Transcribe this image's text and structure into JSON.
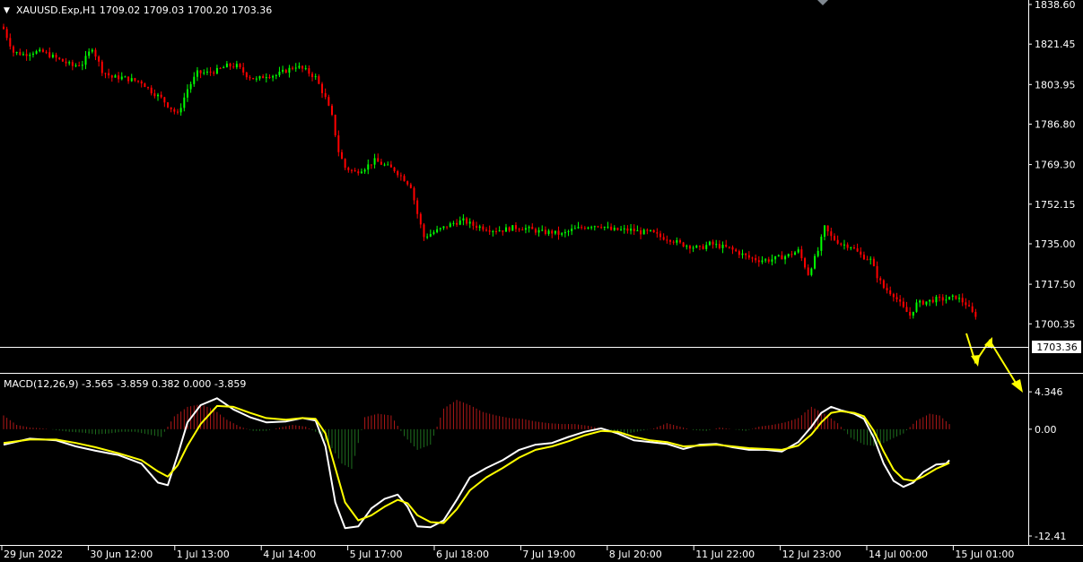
{
  "header": {
    "symbol_menu_glyph": "▼",
    "title": "XAUUSD.Exp,H1  1709.02 1709.03 1700.20 1703.36"
  },
  "macd_header": "MACD(12,26,9) -3.565 -3.859 0.382 0.000 -3.859",
  "colors": {
    "background": "#000000",
    "bull": "#00ff00",
    "bear": "#ff0000",
    "hist_pos": "#b01818",
    "hist_neg": "#1e6e1e",
    "macd_line": "#ffffff",
    "signal_line": "#ffff00",
    "arrow": "#ffff00",
    "axis": "#ffffff"
  },
  "chart_data": [
    {
      "type": "candlestick",
      "title": "XAUUSD.Exp,H1  1709.02 1709.03 1700.20 1703.36",
      "ylim": [
        1686.5,
        1838.6
      ],
      "y_ticks": [
        "1838.60",
        "1821.45",
        "1803.95",
        "1786.80",
        "1769.30",
        "1752.15",
        "1735.00",
        "1717.50",
        "1700.35"
      ],
      "x_ticks": [
        "29 Jun 2022",
        "30 Jun 12:00",
        "1 Jul 13:00",
        "4 Jul 14:00",
        "5 Jul 17:00",
        "6 Jul 18:00",
        "7 Jul 19:00",
        "8 Jul 20:00",
        "11 Jul 22:00",
        "12 Jul 23:00",
        "14 Jul 00:00",
        "15 Jul 01:00"
      ],
      "last_price_label": "1703.36",
      "last_price": 1703.36,
      "close_path": [
        [
          0,
          1828
        ],
        [
          3,
          1818
        ],
        [
          6,
          1817
        ],
        [
          9,
          1818
        ],
        [
          12,
          1818
        ],
        [
          15,
          1816
        ],
        [
          18,
          1814
        ],
        [
          21,
          1812
        ],
        [
          24,
          1813
        ],
        [
          27,
          1820
        ],
        [
          30,
          1810
        ],
        [
          33,
          1807
        ],
        [
          36,
          1807
        ],
        [
          39,
          1806
        ],
        [
          42,
          1805
        ],
        [
          45,
          1801
        ],
        [
          48,
          1798
        ],
        [
          50,
          1795
        ],
        [
          53,
          1791
        ],
        [
          56,
          1802
        ],
        [
          59,
          1809
        ],
        [
          62,
          1809
        ],
        [
          65,
          1810
        ],
        [
          68,
          1812
        ],
        [
          71,
          1812
        ],
        [
          74,
          1808
        ],
        [
          77,
          1806
        ],
        [
          80,
          1808
        ],
        [
          83,
          1808
        ],
        [
          86,
          1810
        ],
        [
          89,
          1812
        ],
        [
          92,
          1810
        ],
        [
          95,
          1807
        ],
        [
          98,
          1798
        ],
        [
          100,
          1790
        ],
        [
          102,
          1775
        ],
        [
          104,
          1768
        ],
        [
          107,
          1766
        ],
        [
          110,
          1768
        ],
        [
          113,
          1771
        ],
        [
          116,
          1769
        ],
        [
          119,
          1767
        ],
        [
          122,
          1763
        ],
        [
          124,
          1760
        ],
        [
          126,
          1748
        ],
        [
          128,
          1738
        ],
        [
          131,
          1740
        ],
        [
          134,
          1742
        ],
        [
          137,
          1744
        ],
        [
          140,
          1745
        ],
        [
          143,
          1743
        ],
        [
          146,
          1742
        ],
        [
          149,
          1741
        ],
        [
          152,
          1741
        ],
        [
          155,
          1742
        ],
        [
          158,
          1742
        ],
        [
          161,
          1741
        ],
        [
          164,
          1740
        ],
        [
          167,
          1740
        ],
        [
          170,
          1739
        ],
        [
          173,
          1741
        ],
        [
          176,
          1742
        ],
        [
          179,
          1743
        ],
        [
          182,
          1743
        ],
        [
          185,
          1741
        ],
        [
          188,
          1741
        ],
        [
          191,
          1741
        ],
        [
          194,
          1740
        ],
        [
          197,
          1740
        ],
        [
          200,
          1738
        ],
        [
          203,
          1737
        ],
        [
          206,
          1735
        ],
        [
          209,
          1734
        ],
        [
          212,
          1733
        ],
        [
          215,
          1735
        ],
        [
          218,
          1734
        ],
        [
          221,
          1733
        ],
        [
          224,
          1731
        ],
        [
          227,
          1729
        ],
        [
          230,
          1728
        ],
        [
          233,
          1728
        ],
        [
          236,
          1729
        ],
        [
          239,
          1730
        ],
        [
          242,
          1732
        ],
        [
          245,
          1722
        ],
        [
          248,
          1732
        ],
        [
          250,
          1742
        ],
        [
          252,
          1738
        ],
        [
          255,
          1735
        ],
        [
          258,
          1734
        ],
        [
          261,
          1730
        ],
        [
          264,
          1728
        ],
        [
          266,
          1721
        ],
        [
          268,
          1716
        ],
        [
          271,
          1713
        ],
        [
          274,
          1707
        ],
        [
          276,
          1704
        ],
        [
          278,
          1709
        ],
        [
          281,
          1710
        ],
        [
          284,
          1711
        ],
        [
          287,
          1711
        ],
        [
          290,
          1712
        ],
        [
          293,
          1709
        ],
        [
          296,
          1703
        ]
      ]
    },
    {
      "type": "line",
      "title": "MACD(12,26,9) -3.565 -3.859 0.382 0.000 -3.859",
      "ylim": [
        -12.41,
        5.4
      ],
      "y_ticks": [
        "4.346",
        "0.00",
        "-12.41"
      ],
      "series": [
        {
          "values": [
            [
              0,
              -1.8
            ],
            [
              8,
              -1.1
            ],
            [
              16,
              -1.3
            ],
            [
              22,
              -2.0
            ],
            [
              28,
              -2.5
            ],
            [
              35,
              -3.0
            ],
            [
              42,
              -4.0
            ],
            [
              47,
              -6.2
            ],
            [
              50,
              -6.5
            ],
            [
              53,
              -3.0
            ],
            [
              56,
              0.8
            ],
            [
              60,
              2.8
            ],
            [
              65,
              3.6
            ],
            [
              70,
              2.3
            ],
            [
              75,
              1.4
            ],
            [
              80,
              0.8
            ],
            [
              86,
              0.9
            ],
            [
              91,
              1.3
            ],
            [
              95,
              1.0
            ],
            [
              98,
              -2.0
            ],
            [
              101,
              -8.5
            ],
            [
              104,
              -11.5
            ],
            [
              108,
              -11.3
            ],
            [
              112,
              -9.2
            ],
            [
              116,
              -8.1
            ],
            [
              120,
              -7.6
            ],
            [
              123,
              -9.0
            ],
            [
              126,
              -11.3
            ],
            [
              130,
              -11.4
            ],
            [
              134,
              -10.6
            ],
            [
              138,
              -8.2
            ],
            [
              142,
              -5.6
            ],
            [
              147,
              -4.5
            ],
            [
              152,
              -3.6
            ],
            [
              157,
              -2.4
            ],
            [
              162,
              -1.8
            ],
            [
              167,
              -1.6
            ],
            [
              172,
              -0.9
            ],
            [
              177,
              -0.3
            ],
            [
              182,
              0.1
            ],
            [
              187,
              -0.5
            ],
            [
              192,
              -1.3
            ],
            [
              197,
              -1.5
            ],
            [
              202,
              -1.7
            ],
            [
              207,
              -2.3
            ],
            [
              212,
              -1.8
            ],
            [
              217,
              -1.7
            ],
            [
              222,
              -2.1
            ],
            [
              227,
              -2.4
            ],
            [
              232,
              -2.4
            ],
            [
              237,
              -2.6
            ],
            [
              242,
              -1.5
            ],
            [
              246,
              0.3
            ],
            [
              249,
              1.9
            ],
            [
              252,
              2.6
            ],
            [
              255,
              2.2
            ],
            [
              259,
              1.8
            ],
            [
              262,
              1.2
            ],
            [
              265,
              -1.0
            ],
            [
              268,
              -4.0
            ],
            [
              271,
              -6.0
            ],
            [
              274,
              -6.7
            ],
            [
              277,
              -6.2
            ],
            [
              280,
              -5.0
            ],
            [
              284,
              -4.1
            ],
            [
              287,
              -4.0
            ],
            [
              288,
              -3.6
            ]
          ]
        },
        {
          "values": [
            [
              0,
              -1.6
            ],
            [
              8,
              -1.2
            ],
            [
              16,
              -1.2
            ],
            [
              22,
              -1.6
            ],
            [
              28,
              -2.1
            ],
            [
              35,
              -2.8
            ],
            [
              42,
              -3.6
            ],
            [
              47,
              -4.9
            ],
            [
              50,
              -5.5
            ],
            [
              53,
              -4.2
            ],
            [
              56,
              -1.9
            ],
            [
              60,
              0.6
            ],
            [
              65,
              2.7
            ],
            [
              70,
              2.6
            ],
            [
              75,
              1.9
            ],
            [
              80,
              1.3
            ],
            [
              86,
              1.1
            ],
            [
              91,
              1.3
            ],
            [
              95,
              1.2
            ],
            [
              98,
              -0.5
            ],
            [
              101,
              -4.5
            ],
            [
              104,
              -8.5
            ],
            [
              108,
              -10.6
            ],
            [
              112,
              -10.0
            ],
            [
              116,
              -9.0
            ],
            [
              120,
              -8.2
            ],
            [
              123,
              -8.6
            ],
            [
              126,
              -10.0
            ],
            [
              130,
              -10.8
            ],
            [
              134,
              -10.9
            ],
            [
              138,
              -9.3
            ],
            [
              142,
              -7.1
            ],
            [
              147,
              -5.6
            ],
            [
              152,
              -4.5
            ],
            [
              157,
              -3.3
            ],
            [
              162,
              -2.4
            ],
            [
              167,
              -2.0
            ],
            [
              172,
              -1.4
            ],
            [
              177,
              -0.7
            ],
            [
              182,
              -0.2
            ],
            [
              187,
              -0.3
            ],
            [
              192,
              -0.9
            ],
            [
              197,
              -1.3
            ],
            [
              202,
              -1.5
            ],
            [
              207,
              -2.0
            ],
            [
              212,
              -1.9
            ],
            [
              217,
              -1.8
            ],
            [
              222,
              -2.0
            ],
            [
              227,
              -2.2
            ],
            [
              232,
              -2.3
            ],
            [
              237,
              -2.4
            ],
            [
              242,
              -1.9
            ],
            [
              246,
              -0.6
            ],
            [
              249,
              0.8
            ],
            [
              252,
              1.9
            ],
            [
              255,
              2.1
            ],
            [
              259,
              1.9
            ],
            [
              262,
              1.5
            ],
            [
              265,
              -0.2
            ],
            [
              268,
              -2.6
            ],
            [
              271,
              -4.7
            ],
            [
              274,
              -5.8
            ],
            [
              277,
              -6.0
            ],
            [
              280,
              -5.5
            ],
            [
              284,
              -4.6
            ],
            [
              287,
              -4.1
            ],
            [
              288,
              -3.9
            ]
          ]
        }
      ],
      "histogram": [
        [
          0,
          1.6
        ],
        [
          4,
          0.5
        ],
        [
          8,
          0.2
        ],
        [
          12,
          0.1
        ],
        [
          16,
          -0.1
        ],
        [
          20,
          -0.3
        ],
        [
          24,
          -0.4
        ],
        [
          28,
          -0.6
        ],
        [
          32,
          -0.5
        ],
        [
          36,
          -0.3
        ],
        [
          40,
          -0.3
        ],
        [
          44,
          -0.6
        ],
        [
          48,
          -0.9
        ],
        [
          52,
          1.5
        ],
        [
          56,
          2.6
        ],
        [
          60,
          2.9
        ],
        [
          64,
          2.3
        ],
        [
          68,
          1.1
        ],
        [
          72,
          0.3
        ],
        [
          76,
          -0.2
        ],
        [
          80,
          -0.2
        ],
        [
          84,
          0.2
        ],
        [
          88,
          0.5
        ],
        [
          92,
          0.3
        ],
        [
          96,
          -0.5
        ],
        [
          100,
          -2.2
        ],
        [
          103,
          -4.0
        ],
        [
          106,
          -4.6
        ],
        [
          110,
          1.4
        ],
        [
          114,
          1.8
        ],
        [
          118,
          1.6
        ],
        [
          122,
          -0.8
        ],
        [
          126,
          -2.4
        ],
        [
          130,
          -1.8
        ],
        [
          134,
          2.4
        ],
        [
          138,
          3.4
        ],
        [
          142,
          2.8
        ],
        [
          146,
          2.0
        ],
        [
          150,
          1.6
        ],
        [
          154,
          1.3
        ],
        [
          158,
          1.2
        ],
        [
          162,
          0.9
        ],
        [
          166,
          0.7
        ],
        [
          170,
          0.6
        ],
        [
          174,
          0.6
        ],
        [
          178,
          0.4
        ],
        [
          182,
          0.1
        ],
        [
          186,
          -0.3
        ],
        [
          190,
          -0.5
        ],
        [
          194,
          -0.2
        ],
        [
          198,
          0.1
        ],
        [
          202,
          0.7
        ],
        [
          206,
          0.3
        ],
        [
          210,
          -0.1
        ],
        [
          214,
          -0.2
        ],
        [
          218,
          0.2
        ],
        [
          222,
          0.0
        ],
        [
          226,
          -0.2
        ],
        [
          230,
          0.3
        ],
        [
          234,
          0.5
        ],
        [
          238,
          0.8
        ],
        [
          242,
          1.3
        ],
        [
          246,
          2.6
        ],
        [
          250,
          1.8
        ],
        [
          254,
          0.7
        ],
        [
          258,
          -1.0
        ],
        [
          262,
          -1.8
        ],
        [
          266,
          -2.0
        ],
        [
          270,
          -1.2
        ],
        [
          274,
          -0.5
        ],
        [
          278,
          1.0
        ],
        [
          282,
          1.8
        ],
        [
          285,
          1.6
        ],
        [
          288,
          0.6
        ]
      ]
    }
  ]
}
